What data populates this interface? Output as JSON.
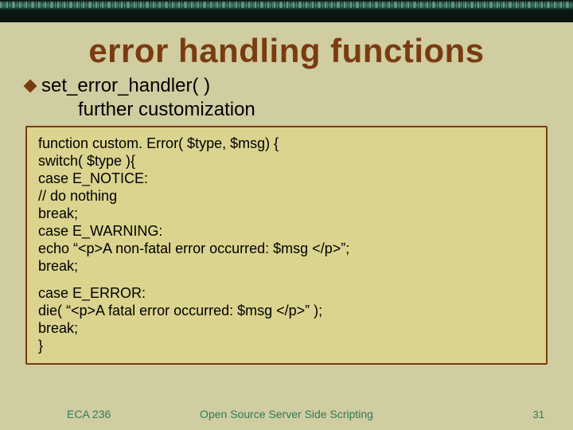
{
  "decor": {
    "topbar": true
  },
  "title": "error handling functions",
  "bullet": {
    "main": "set_error_handler( )",
    "sub": "further customization"
  },
  "code": {
    "lines_a": [
      "function custom. Error( $type, $msg) {",
      "switch( $type ){",
      "case E_NOTICE:",
      "// do nothing",
      "break;",
      "case E_WARNING:",
      "echo “<p>A non-fatal error occurred: $msg </p>”;",
      "break;"
    ],
    "lines_b": [
      "case E_ERROR:",
      "die( “<p>A fatal error occurred: $msg </p>” );",
      "break;",
      "}"
    ]
  },
  "footer": {
    "course": "ECA 236",
    "subtitle": "Open Source Server Side Scripting",
    "pagenum": "31"
  }
}
